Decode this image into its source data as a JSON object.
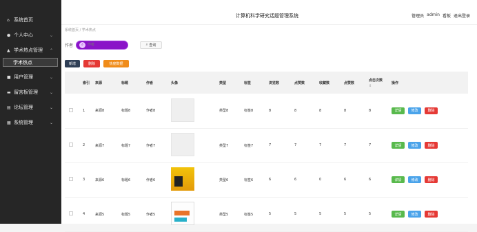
{
  "sidebar": {
    "items": [
      {
        "label": "系统首页",
        "icon": "home-icon"
      },
      {
        "label": "个人中心",
        "icon": "person-icon"
      },
      {
        "label": "学术热点管理",
        "icon": "hot-topic-icon"
      },
      {
        "label": "学术热点",
        "icon": ""
      },
      {
        "label": "用户管理",
        "icon": "user-icon"
      },
      {
        "label": "留言板管理",
        "icon": "message-icon"
      },
      {
        "label": "论坛管理",
        "icon": "forum-icon"
      },
      {
        "label": "系统管理",
        "icon": "settings-icon"
      }
    ]
  },
  "header": {
    "title": "计算机科学研究话题管理系统",
    "role": "管理员",
    "username": "admin",
    "home_link": "看板",
    "logout_link": "退出登录"
  },
  "breadcrumb": {
    "home": "系统首页",
    "sep": "/",
    "current": "学术热点"
  },
  "search": {
    "label": "作者",
    "placeholder": "作者",
    "button": "查询"
  },
  "actions": {
    "add": "新增",
    "delete": "删除",
    "stats": "热度数据"
  },
  "table": {
    "headers": {
      "index": "索引",
      "source": "来源",
      "title": "标题",
      "author": "作者",
      "avatar": "头像",
      "type": "类型",
      "tag": "标签",
      "views": "浏览数",
      "likes": "点赞数",
      "favorites": "收藏数",
      "favorites2": "点赞数",
      "clicks": "点击次数",
      "ops": "操作"
    },
    "rows": [
      {
        "index": "1",
        "source": "来源8",
        "title": "标题8",
        "author": "作者8",
        "type": "类型8",
        "tag": "标签8",
        "v1": "8",
        "v2": "8",
        "v3": "8",
        "v4": "8",
        "v5": "8"
      },
      {
        "index": "2",
        "source": "来源7",
        "title": "标题7",
        "author": "作者7",
        "type": "类型7",
        "tag": "标签7",
        "v1": "7",
        "v2": "7",
        "v3": "7",
        "v4": "7",
        "v5": "7"
      },
      {
        "index": "3",
        "source": "来源6",
        "title": "标题6",
        "author": "作者6",
        "type": "类型6",
        "tag": "标签6",
        "v1": "6",
        "v2": "6",
        "v3": "0",
        "v4": "6",
        "v5": "6"
      },
      {
        "index": "4",
        "source": "来源5",
        "title": "标题5",
        "author": "作者5",
        "type": "类型5",
        "tag": "标签5",
        "v1": "5",
        "v2": "5",
        "v3": "5",
        "v4": "5",
        "v5": "5"
      }
    ],
    "op_detail": "详情",
    "op_edit": "修改",
    "op_delete": "删除"
  }
}
